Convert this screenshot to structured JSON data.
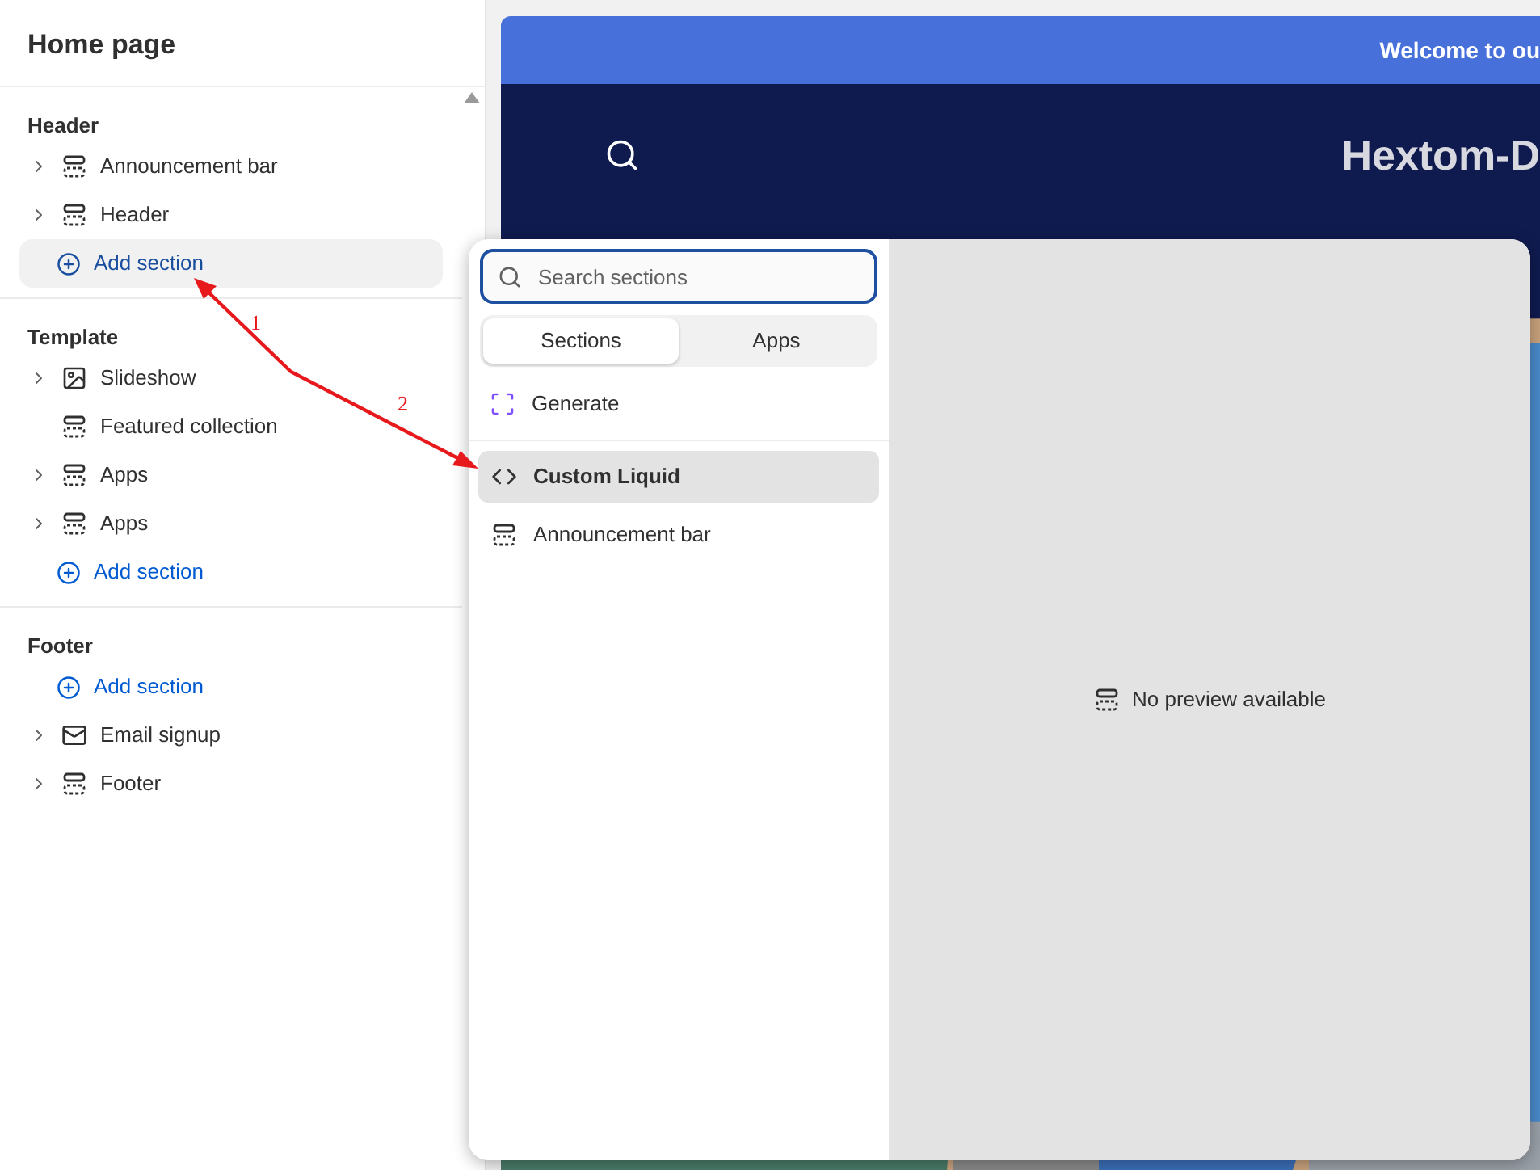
{
  "sidebar": {
    "title": "Home page",
    "groups": [
      {
        "title": "Header",
        "items": [
          {
            "kind": "section",
            "label": "Announcement bar",
            "expandable": true
          },
          {
            "kind": "section",
            "label": "Header",
            "expandable": true
          },
          {
            "kind": "add",
            "label": "Add section",
            "highlighted": true
          }
        ]
      },
      {
        "title": "Template",
        "items": [
          {
            "kind": "image-section",
            "label": "Slideshow",
            "expandable": true
          },
          {
            "kind": "section",
            "label": "Featured collection",
            "expandable": false
          },
          {
            "kind": "section",
            "label": "Apps",
            "expandable": true
          },
          {
            "kind": "section",
            "label": "Apps",
            "expandable": true
          },
          {
            "kind": "add",
            "label": "Add section",
            "highlighted": false
          }
        ]
      },
      {
        "title": "Footer",
        "items": [
          {
            "kind": "add",
            "label": "Add section",
            "highlighted": false
          },
          {
            "kind": "email-section",
            "label": "Email signup",
            "expandable": true
          },
          {
            "kind": "section",
            "label": "Footer",
            "expandable": true
          }
        ]
      }
    ]
  },
  "preview": {
    "announcement": "Welcome to ou",
    "store_name": "Hextom-D"
  },
  "picker": {
    "search": {
      "placeholder": "Search sections"
    },
    "tabs": [
      {
        "label": "Sections",
        "selected": true
      },
      {
        "label": "Apps",
        "selected": false
      }
    ],
    "generate": "Generate",
    "items": [
      {
        "kind": "code",
        "label": "Custom Liquid",
        "selected": true
      },
      {
        "kind": "section",
        "label": "Announcement bar",
        "selected": false
      }
    ],
    "preview_message": "No preview available"
  },
  "annotations": [
    "1",
    "2"
  ]
}
